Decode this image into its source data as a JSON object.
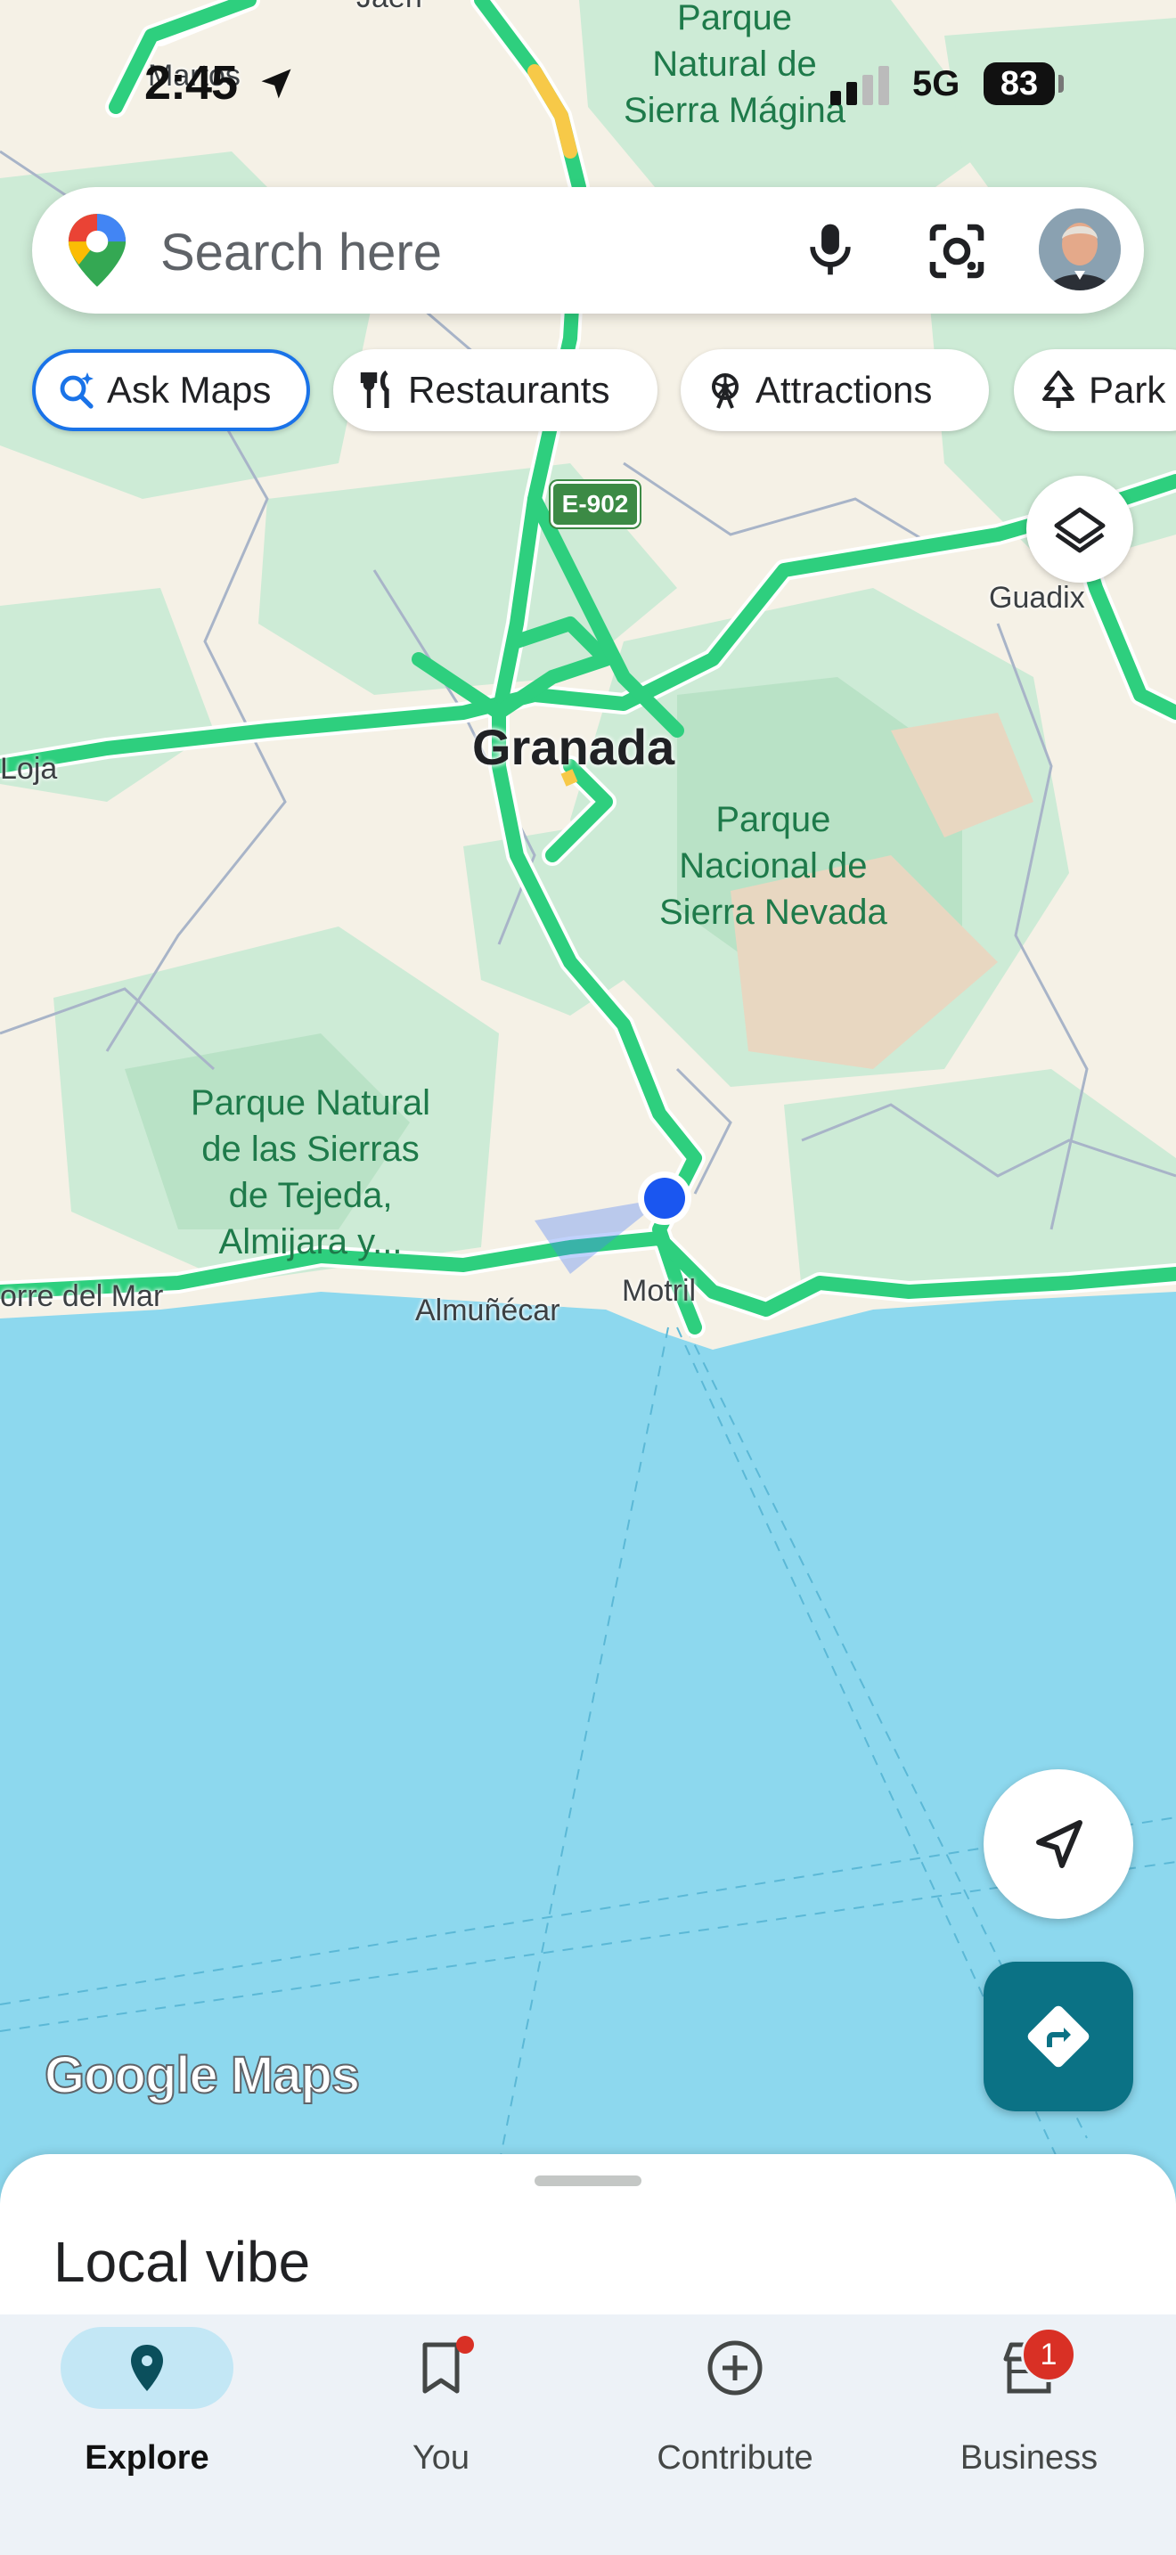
{
  "status_bar": {
    "time": "2:45",
    "network": "5G",
    "battery": "83"
  },
  "search": {
    "placeholder": "Search here"
  },
  "chips": [
    {
      "label": "Ask Maps",
      "icon": "sparkle-search-icon"
    },
    {
      "label": "Restaurants",
      "icon": "fork-knife-icon"
    },
    {
      "label": "Attractions",
      "icon": "ferris-wheel-icon"
    },
    {
      "label": "Park",
      "icon": "tree-icon"
    }
  ],
  "map": {
    "road_shield": "E-902",
    "city": "Granada",
    "labels": {
      "sierra_magina": "Parque\nNatural de\nSierra Mágina",
      "sierra_nevada": "Parque\nNacional de\nSierra Nevada",
      "tejeda": "Parque Natural\nde las Sierras\nde Tejeda,\nAlmijara y...",
      "jaen": "Jaén",
      "martos": "Martos",
      "guadix": "Guadix",
      "loja": "Loja",
      "torre": "orre del Mar",
      "almunecar": "Almuñécar",
      "motril": "Motril"
    },
    "colors": {
      "land": "#f5f1e6",
      "park": "#c9ebd3",
      "sea": "#8dd8ee",
      "highway": "#2ecf7e",
      "location": "#1a56f0"
    }
  },
  "logo": "Google Maps",
  "sheet": {
    "title": "Local vibe"
  },
  "nav": [
    {
      "label": "Explore",
      "icon": "location-pin-icon",
      "active": true
    },
    {
      "label": "You",
      "icon": "bookmark-icon"
    },
    {
      "label": "Contribute",
      "icon": "plus-circle-icon"
    },
    {
      "label": "Business",
      "icon": "storefront-icon",
      "badge": "1"
    }
  ]
}
